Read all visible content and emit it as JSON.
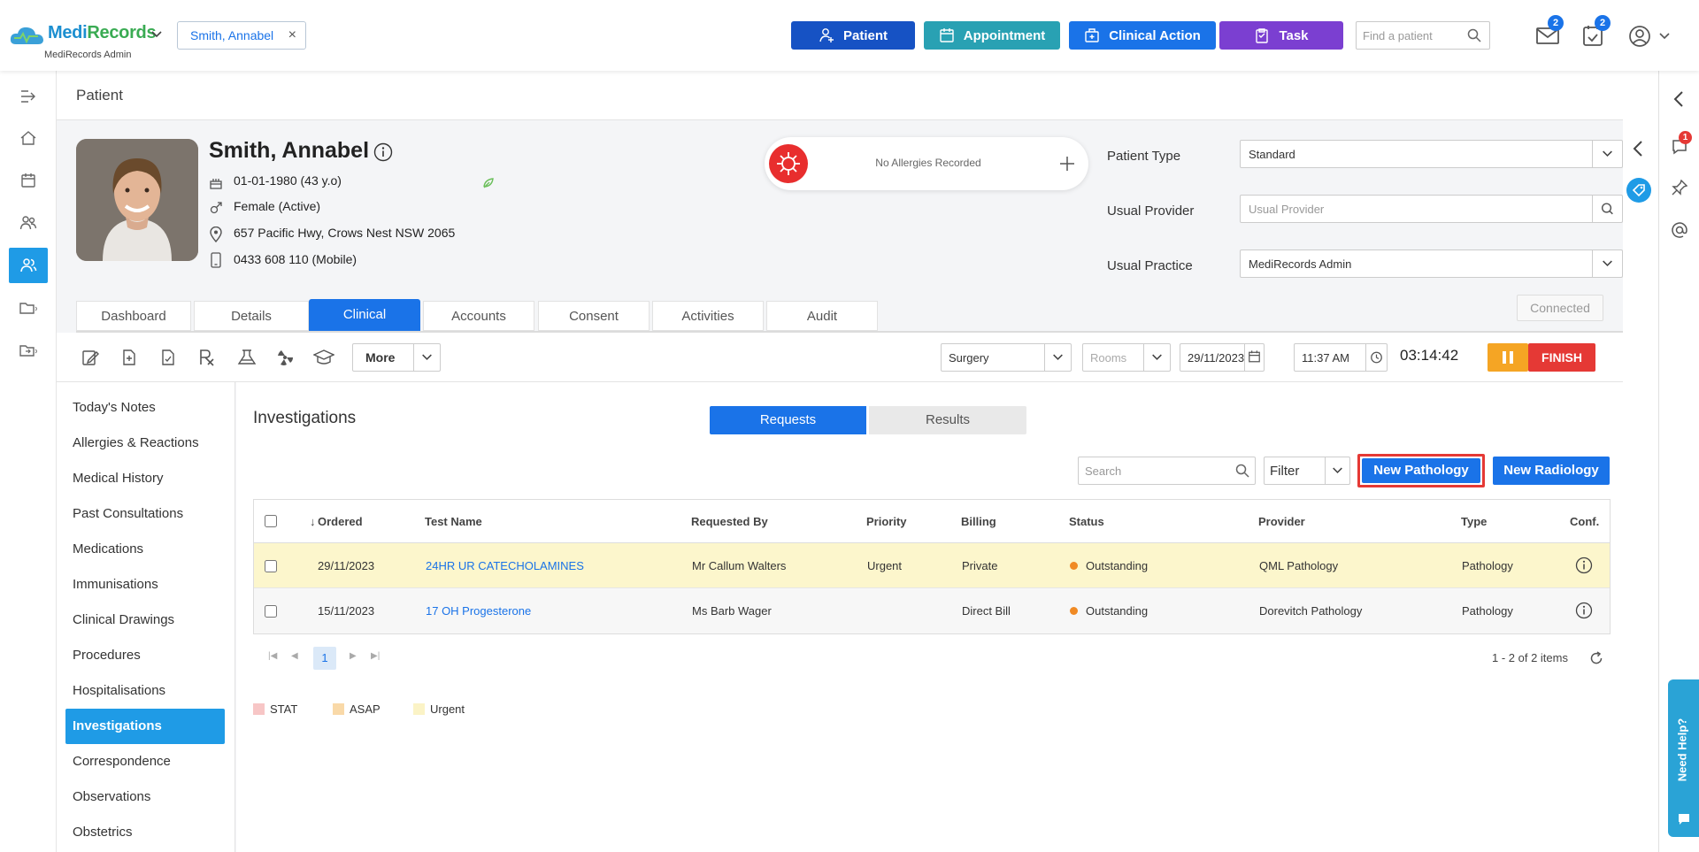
{
  "app": {
    "brand_a": "Medi",
    "brand_b": "Records",
    "sub": "MediRecords Admin"
  },
  "header": {
    "patient_chip": "Smith, Annabel",
    "buttons": [
      {
        "label": "Patient",
        "color": "#1652c4"
      },
      {
        "label": "Appointment",
        "color": "#29a1b3"
      },
      {
        "label": "Clinical Action",
        "color": "#1a73e8"
      },
      {
        "label": "Task",
        "color": "#7b3fd1"
      }
    ],
    "find_placeholder": "Find a patient",
    "mail_count": "2",
    "task_count": "2"
  },
  "page_title": "Patient",
  "patient": {
    "name": "Smith, Annabel",
    "dob": "01-01-1980 (43 y.o)",
    "gender": "Female (Active)",
    "address": "657 Pacific Hwy, Crows Nest NSW 2065",
    "phone": "0433 608 110 (Mobile)",
    "allergies": "No Allergies Recorded",
    "fields": {
      "patient_type_label": "Patient Type",
      "patient_type": "Standard",
      "usual_provider_label": "Usual Provider",
      "usual_provider_placeholder": "Usual Provider",
      "usual_practice_label": "Usual Practice",
      "usual_practice": "MediRecords Admin"
    },
    "connected": "Connected",
    "alert_count": "1"
  },
  "tabs": [
    "Dashboard",
    "Details",
    "Clinical",
    "Accounts",
    "Consent",
    "Activities",
    "Audit"
  ],
  "toolbar": {
    "more": "More",
    "location": "Surgery",
    "rooms_placeholder": "Rooms",
    "date": "29/11/2023",
    "time": "11:37 AM",
    "timer": "03:14:42",
    "finish": "FINISH"
  },
  "nav": [
    "Today's Notes",
    "Allergies & Reactions",
    "Medical History",
    "Past Consultations",
    "Medications",
    "Immunisations",
    "Clinical Drawings",
    "Procedures",
    "Hospitalisations",
    "Investigations",
    "Correspondence",
    "Observations",
    "Obstetrics"
  ],
  "investigations": {
    "title": "Investigations",
    "toggle": [
      "Requests",
      "Results"
    ],
    "search_placeholder": "Search",
    "filter": "Filter",
    "new_pathology": "New Pathology",
    "new_radiology": "New Radiology",
    "columns": [
      "Ordered",
      "Test Name",
      "Requested By",
      "Priority",
      "Billing",
      "Status",
      "Provider",
      "Type",
      "Conf."
    ],
    "rows": [
      {
        "ordered": "29/11/2023",
        "test": "24HR UR CATECHOLAMINES",
        "requested_by": "Mr Callum Walters",
        "priority": "Urgent",
        "billing": "Private",
        "status": "Outstanding",
        "provider": "QML Pathology",
        "type": "Pathology"
      },
      {
        "ordered": "15/11/2023",
        "test": "17 OH Progesterone",
        "requested_by": "Ms Barb Wager",
        "priority": "",
        "billing": "Direct Bill",
        "status": "Outstanding",
        "provider": "Dorevitch Pathology",
        "type": "Pathology"
      }
    ],
    "page": "1",
    "items": "1 - 2 of 2 items",
    "legend": [
      {
        "label": "STAT",
        "color": "#f7c6c6"
      },
      {
        "label": "ASAP",
        "color": "#f9d9a8"
      },
      {
        "label": "Urgent",
        "color": "#fbf3c6"
      }
    ]
  },
  "need_help": "Need Help?"
}
